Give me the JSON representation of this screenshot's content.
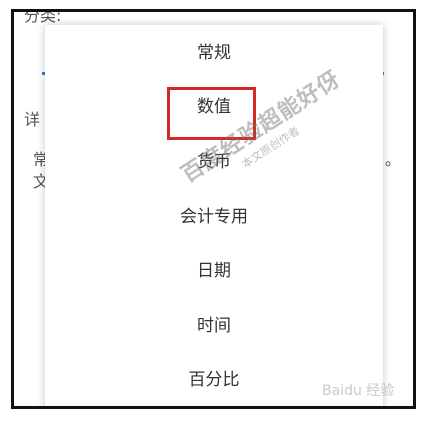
{
  "background": {
    "top_partial": "分类:",
    "detail_partial": "详",
    "side_partial_1": "常",
    "side_partial_2": "文",
    "right_partial": "。"
  },
  "dropdown": {
    "options": [
      {
        "label": "常规"
      },
      {
        "label": "数值",
        "highlighted": true
      },
      {
        "label": "货币"
      },
      {
        "label": "会计专用"
      },
      {
        "label": "日期"
      },
      {
        "label": "时间"
      },
      {
        "label": "百分比"
      }
    ]
  },
  "watermark": {
    "main": "百度经验超能好伢",
    "sub": "本文原创作者",
    "corner": "Baidu 经验"
  },
  "colors": {
    "highlight": "#d42a26",
    "frame": "#111111",
    "accent_dot": "#2f7fd0"
  }
}
